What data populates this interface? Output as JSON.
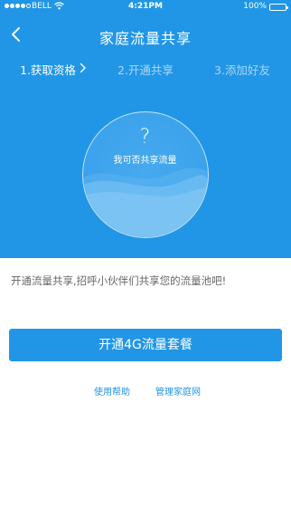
{
  "status_bar": {
    "carrier": "BELL",
    "time": "4:21PM",
    "battery": "100%",
    "signal_bars": 4,
    "signal_max": 5
  },
  "header": {
    "title": "家庭流量共享"
  },
  "steps": [
    {
      "label": "1.获取资格",
      "active": true
    },
    {
      "label": "2.开通共享",
      "active": false
    },
    {
      "label": "3.添加好友",
      "active": false
    }
  ],
  "circle": {
    "symbol": "?",
    "caption": "我可否共享流量"
  },
  "description": "开通流量共享,招呼小伙伴们共享您的流量池吧!",
  "primary_button": "开通4G流量套餐",
  "links": {
    "help": "使用帮助",
    "manage": "管理家庭网"
  },
  "colors": {
    "brand": "#2196e6",
    "inactive_step": "#a9d6f8",
    "body_text": "#666666",
    "background": "#ffffff"
  },
  "icons": [
    "signal-icon",
    "wifi-icon",
    "battery-icon",
    "back-arrow-icon",
    "chevron-right-icon",
    "question-mark-icon"
  ]
}
